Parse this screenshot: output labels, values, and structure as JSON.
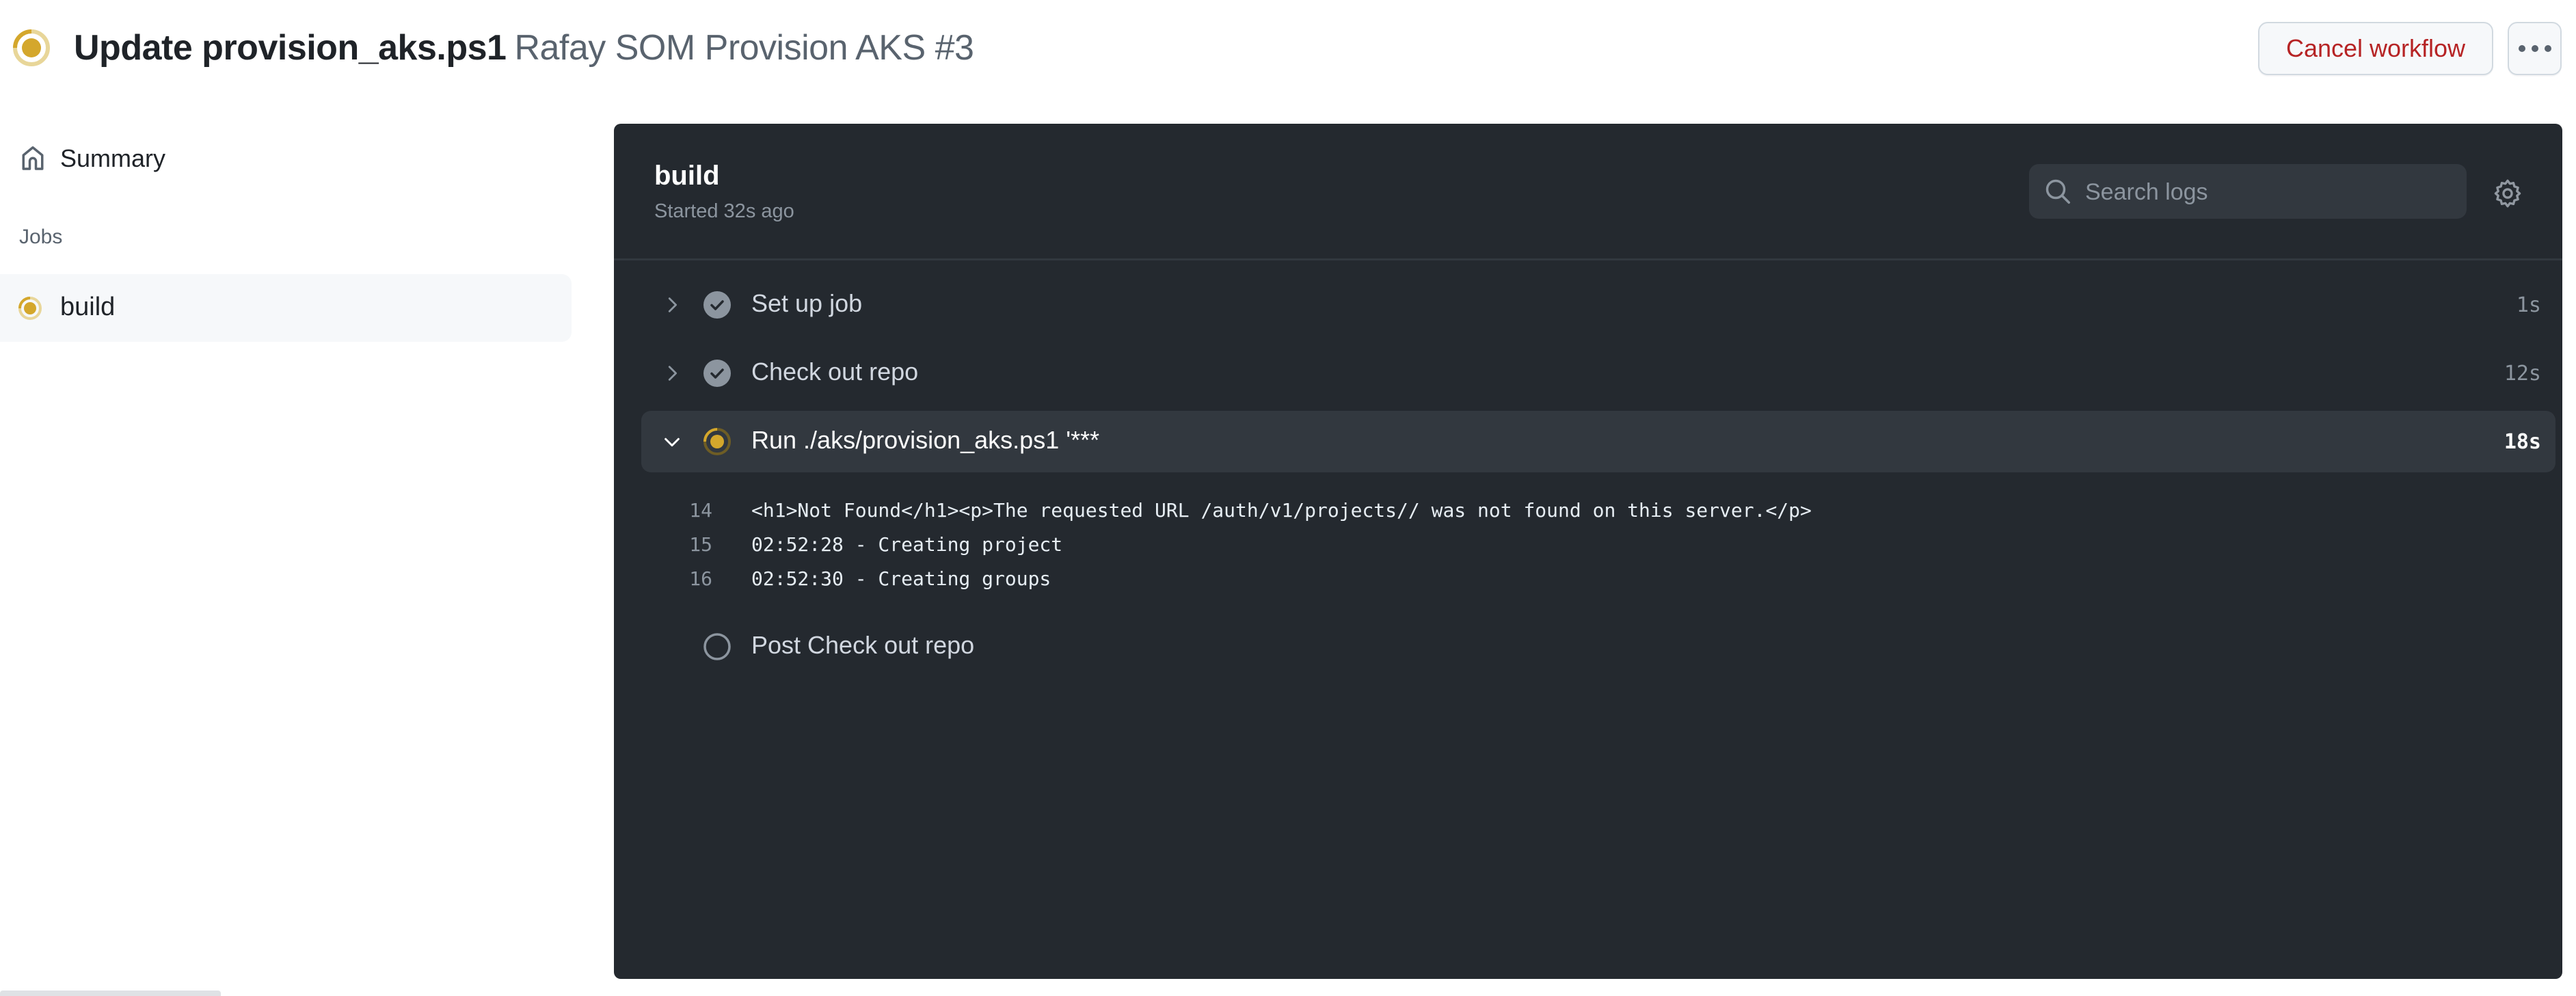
{
  "header": {
    "status": "in_progress",
    "title": "Update provision_aks.ps1",
    "workflow": "Rafay SOM Provision AKS #3",
    "cancel_label": "Cancel workflow",
    "more_icon": "kebab-horizontal-icon"
  },
  "sidebar": {
    "summary_label": "Summary",
    "summary_icon": "home-icon",
    "jobs_heading": "Jobs",
    "jobs": [
      {
        "label": "build",
        "status": "in_progress",
        "selected": true
      }
    ]
  },
  "panel": {
    "job_title": "build",
    "started": "Started 32s ago",
    "search_placeholder": "Search logs",
    "settings_icon": "gear-icon",
    "steps": [
      {
        "name": "Set up job",
        "duration": "1s",
        "status": "success",
        "expanded": false
      },
      {
        "name": "Check out repo",
        "duration": "12s",
        "status": "success",
        "expanded": false
      },
      {
        "name": "Run ./aks/provision_aks.ps1 '***",
        "duration": "18s",
        "status": "in_progress",
        "expanded": true
      },
      {
        "name": "Post Check out repo",
        "duration": "",
        "status": "pending",
        "expanded": false
      }
    ],
    "log_lines": [
      {
        "num": "14",
        "text": "<h1>Not Found</h1><p>The requested URL /auth/v1/projects// was not found on this server.</p>"
      },
      {
        "num": "15",
        "text": "02:52:28 - Creating project"
      },
      {
        "num": "16",
        "text": "02:52:30 - Creating groups"
      }
    ]
  },
  "colors": {
    "in_progress": "#d4a72c",
    "success_icon": "#8c959f",
    "danger_text": "#b62324",
    "panel_bg": "#24292f"
  }
}
